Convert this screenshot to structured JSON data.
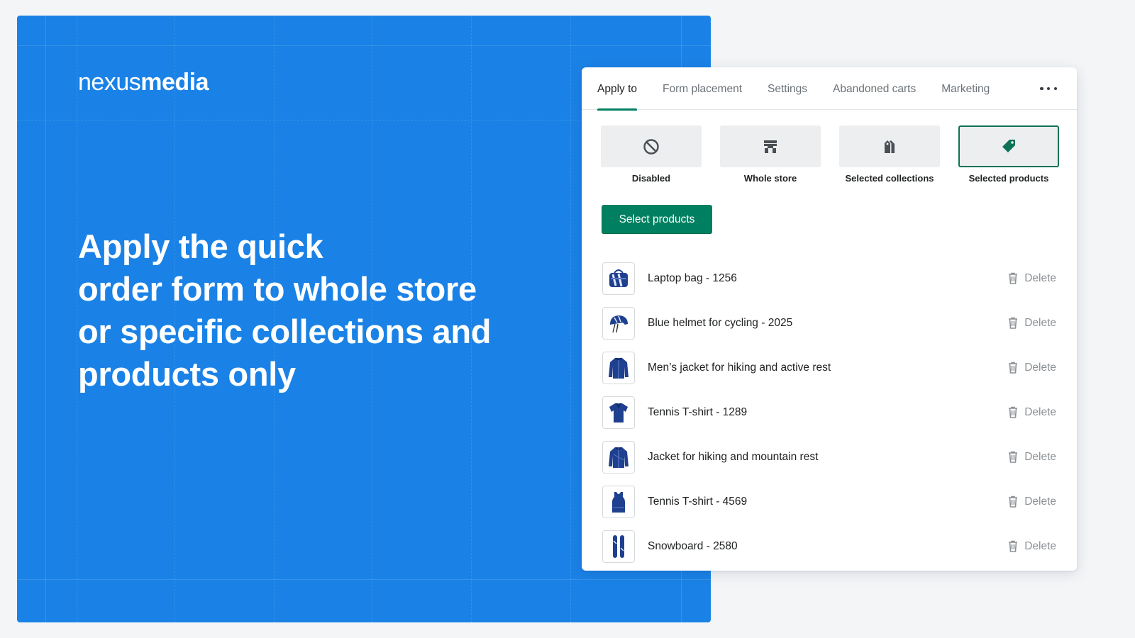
{
  "brand": {
    "light": "nexus",
    "bold": "media"
  },
  "headline": [
    "Apply the quick",
    "order form to whole store",
    "or specific collections and",
    "products only"
  ],
  "tabs": [
    {
      "label": "Apply to",
      "active": true
    },
    {
      "label": "Form placement",
      "active": false
    },
    {
      "label": "Settings",
      "active": false
    },
    {
      "label": "Abandoned carts",
      "active": false
    },
    {
      "label": "Marketing",
      "active": false
    }
  ],
  "more_icon": "ellipsis-icon",
  "options": [
    {
      "label": "Disabled",
      "icon": "disabled-icon",
      "selected": false
    },
    {
      "label": "Whole store",
      "icon": "store-icon",
      "selected": false
    },
    {
      "label": "Selected collections",
      "icon": "collections-icon",
      "selected": false
    },
    {
      "label": "Selected products",
      "icon": "tag-icon",
      "selected": true
    }
  ],
  "select_button": "Select products",
  "delete_label": "Delete",
  "products": [
    {
      "name": "Laptop bag - 1256",
      "icon": "bag-thumbnail"
    },
    {
      "name": "Blue helmet for cycling - 2025",
      "icon": "helmet-thumbnail"
    },
    {
      "name": "Men’s jacket for hiking and active rest",
      "icon": "jacket-thumbnail"
    },
    {
      "name": "Tennis T-shirt - 1289",
      "icon": "tshirt-thumbnail"
    },
    {
      "name": "Jacket for hiking and mountain rest",
      "icon": "jacket-thumbnail"
    },
    {
      "name": "Tennis T-shirt - 4569",
      "icon": "tanktop-thumbnail"
    },
    {
      "name": "Snowboard - 2580",
      "icon": "snowboard-thumbnail"
    }
  ],
  "colors": {
    "hero_blue": "#1a82e6",
    "primary_green": "#008060",
    "product_navy": "#1f3f8f"
  }
}
